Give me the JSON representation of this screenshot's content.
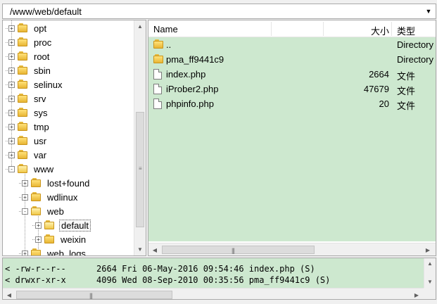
{
  "path_bar": {
    "value": "/www/web/default",
    "dropdown_icon": "chevron-down-icon"
  },
  "tree": {
    "items": [
      {
        "label": "opt",
        "level": 0,
        "expander": "+"
      },
      {
        "label": "proc",
        "level": 0,
        "expander": "+"
      },
      {
        "label": "root",
        "level": 0,
        "expander": "+"
      },
      {
        "label": "sbin",
        "level": 0,
        "expander": "+"
      },
      {
        "label": "selinux",
        "level": 0,
        "expander": "+"
      },
      {
        "label": "srv",
        "level": 0,
        "expander": "+"
      },
      {
        "label": "sys",
        "level": 0,
        "expander": "+"
      },
      {
        "label": "tmp",
        "level": 0,
        "expander": "+"
      },
      {
        "label": "usr",
        "level": 0,
        "expander": "+"
      },
      {
        "label": "var",
        "level": 0,
        "expander": "+"
      },
      {
        "label": "www",
        "level": 0,
        "expander": "−"
      },
      {
        "label": "lost+found",
        "level": 1,
        "expander": "+"
      },
      {
        "label": "wdlinux",
        "level": 1,
        "expander": "+"
      },
      {
        "label": "web",
        "level": 1,
        "expander": "−"
      },
      {
        "label": "default",
        "level": 2,
        "expander": "+",
        "selected": true
      },
      {
        "label": "weixin",
        "level": 2,
        "expander": "+"
      },
      {
        "label": "web_logs",
        "level": 1,
        "expander": "+"
      }
    ]
  },
  "file_list": {
    "columns": {
      "name": "Name",
      "size": "大小",
      "type": "类型"
    },
    "rows": [
      {
        "name": "..",
        "size": "",
        "type": "Directory",
        "icon": "folder-icon"
      },
      {
        "name": "pma_ff9441c9",
        "size": "",
        "type": "Directory",
        "icon": "folder-icon"
      },
      {
        "name": "index.php",
        "size": "2664",
        "type": "文件",
        "icon": "file-icon"
      },
      {
        "name": "iProber2.php",
        "size": "47679",
        "type": "文件",
        "icon": "file-icon"
      },
      {
        "name": "phpinfo.php",
        "size": "20",
        "type": "文件",
        "icon": "file-icon"
      }
    ]
  },
  "log": {
    "lines": [
      "< -rw-r--r--      2664 Fri 06-May-2016 09:54:46 index.php (S)",
      "< drwxr-xr-x      4096 Wed 08-Sep-2010 00:35:56 pma_ff9441c9 (S)"
    ]
  },
  "colors": {
    "list_background": "#cde8cf",
    "folder": "#f0c848"
  }
}
